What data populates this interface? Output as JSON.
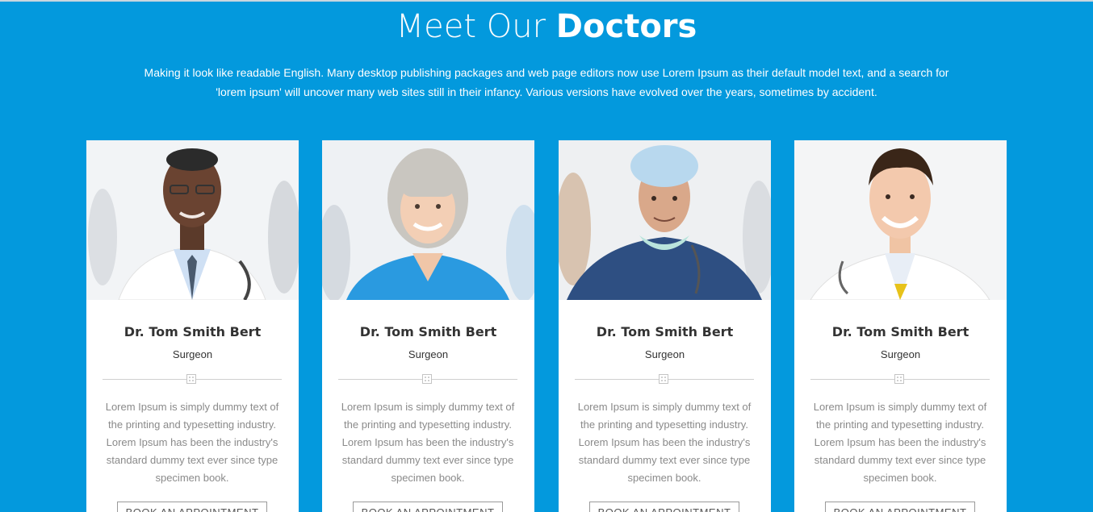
{
  "section": {
    "title_light": "Meet Our",
    "title_bold": "Doctors",
    "intro": "Making it look like readable English. Many desktop publishing packages and web page editors now use Lorem Ipsum as their default model text, and a search for 'lorem ipsum' will uncover many web sites still in their infancy. Various versions have evolved over the years, sometimes by accident."
  },
  "doctors": [
    {
      "name": "Dr. Tom Smith Bert",
      "role": "Surgeon",
      "description": "Lorem Ipsum is simply dummy text of the printing and typesetting industry. Lorem Ipsum has been the industry's standard dummy text ever since type specimen book.",
      "button": "BOOK AN APPOINTMENT",
      "icon": "doctor-photo-icon"
    },
    {
      "name": "Dr. Tom Smith Bert",
      "role": "Surgeon",
      "description": "Lorem Ipsum is simply dummy text of the printing and typesetting industry. Lorem Ipsum has been the industry's standard dummy text ever since type specimen book.",
      "button": "BOOK AN APPOINTMENT",
      "icon": "doctor-photo-icon"
    },
    {
      "name": "Dr. Tom Smith Bert",
      "role": "Surgeon",
      "description": "Lorem Ipsum is simply dummy text of the printing and typesetting industry. Lorem Ipsum has been the industry's standard dummy text ever since type specimen book.",
      "button": "BOOK AN APPOINTMENT",
      "icon": "doctor-photo-icon"
    },
    {
      "name": "Dr. Tom Smith Bert",
      "role": "Surgeon",
      "description": "Lorem Ipsum is simply dummy text of the printing and typesetting industry. Lorem Ipsum has been the industry's standard dummy text ever since type specimen book.",
      "button": "BOOK AN APPOINTMENT",
      "icon": "doctor-photo-icon"
    }
  ],
  "colors": {
    "background": "#0399dd",
    "card": "#ffffff",
    "heading_text": "#333333",
    "body_text": "#8a8a8a"
  }
}
